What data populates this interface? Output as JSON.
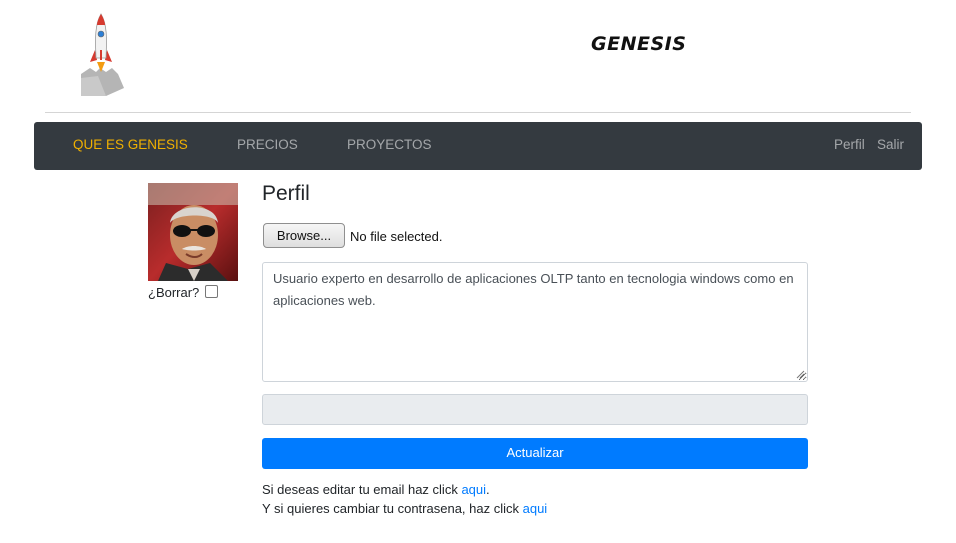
{
  "header": {
    "brand": "GENESIS",
    "logo_icon": "rocket-icon"
  },
  "navbar": {
    "left_items": [
      "QUE ES GENESIS",
      "PRECIOS",
      "PROYECTOS"
    ],
    "active_item": "QUE ES GENESIS",
    "right_items": [
      "Perfil",
      "Salir"
    ],
    "active_color": "#f0b000",
    "background_color": "#343a40"
  },
  "avatar": {
    "delete_label": "¿Borrar?",
    "delete_checked": false
  },
  "profile": {
    "title": "Perfil",
    "browse_label": "Browse...",
    "file_status": "No file selected.",
    "bio": "Usuario experto en desarrollo de aplicaciones OLTP tanto en tecnologia windows como en aplicaciones web.",
    "disabled_value": "",
    "submit_label": "Actualizar",
    "submit_color": "#007bff"
  },
  "help": {
    "email_prefix": "Si deseas editar tu email haz click ",
    "email_link": "aqui",
    "email_suffix": ".",
    "password_prefix": "Y si quieres cambiar tu contrasena, haz click ",
    "password_link": "aqui"
  }
}
